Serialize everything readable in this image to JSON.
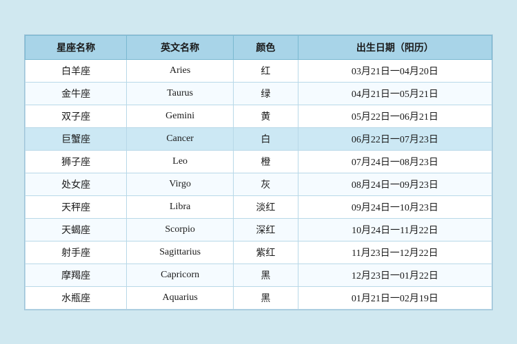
{
  "table": {
    "headers": [
      "星座名称",
      "英文名称",
      "颜色",
      "出生日期（阳历）"
    ],
    "rows": [
      {
        "chinese": "白羊座",
        "english": "Aries",
        "color": "红",
        "dates": "03月21日一04月20日",
        "highlight": false
      },
      {
        "chinese": "金牛座",
        "english": "Taurus",
        "color": "绿",
        "dates": "04月21日一05月21日",
        "highlight": false
      },
      {
        "chinese": "双子座",
        "english": "Gemini",
        "color": "黄",
        "dates": "05月22日一06月21日",
        "highlight": false
      },
      {
        "chinese": "巨蟹座",
        "english": "Cancer",
        "color": "白",
        "dates": "06月22日一07月23日",
        "highlight": true
      },
      {
        "chinese": "狮子座",
        "english": "Leo",
        "color": "橙",
        "dates": "07月24日一08月23日",
        "highlight": false
      },
      {
        "chinese": "处女座",
        "english": "Virgo",
        "color": "灰",
        "dates": "08月24日一09月23日",
        "highlight": false
      },
      {
        "chinese": "天秤座",
        "english": "Libra",
        "color": "淡红",
        "dates": "09月24日一10月23日",
        "highlight": false
      },
      {
        "chinese": "天蝎座",
        "english": "Scorpio",
        "color": "深红",
        "dates": "10月24日一11月22日",
        "highlight": false
      },
      {
        "chinese": "射手座",
        "english": "Sagittarius",
        "color": "紫红",
        "dates": "11月23日一12月22日",
        "highlight": false
      },
      {
        "chinese": "摩羯座",
        "english": "Capricorn",
        "color": "黑",
        "dates": "12月23日一01月22日",
        "highlight": false
      },
      {
        "chinese": "水瓶座",
        "english": "Aquarius",
        "color": "黑",
        "dates": "01月21日一02月19日",
        "highlight": false
      }
    ]
  }
}
